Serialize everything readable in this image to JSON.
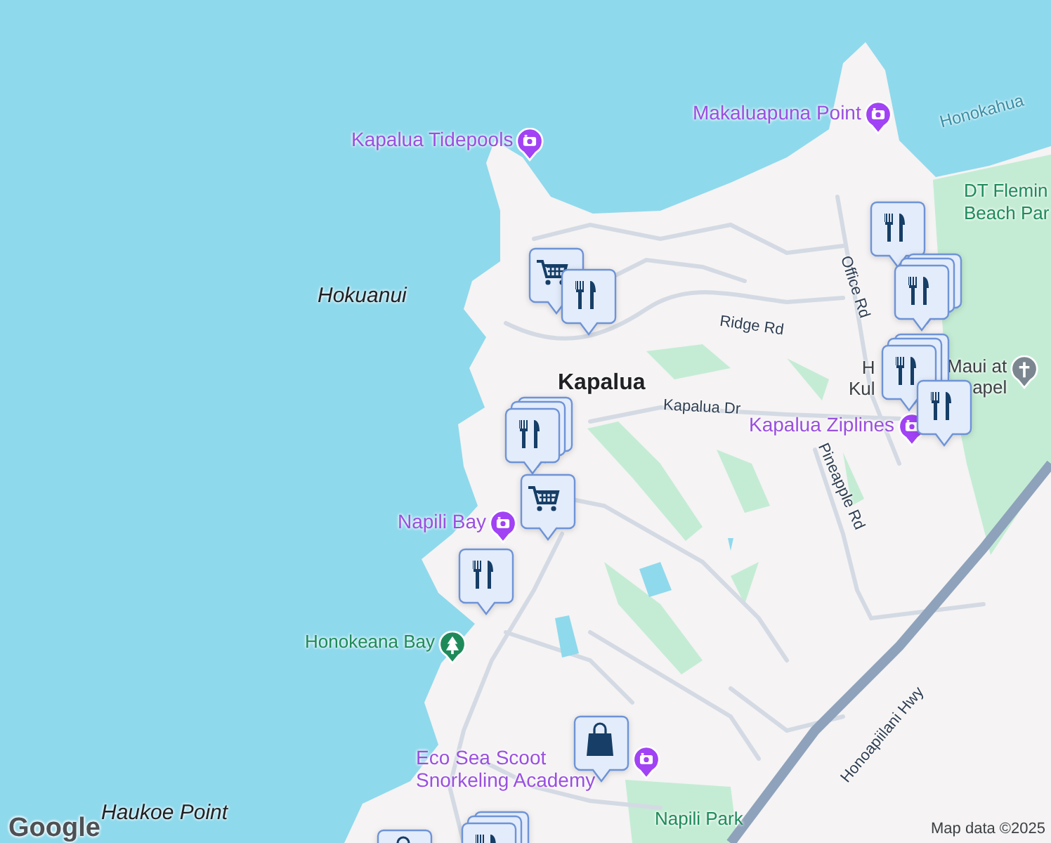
{
  "map": {
    "labels": [
      {
        "kind": "poi",
        "lines": [
          "Makaluapuna Point"
        ],
        "pinned": true
      },
      {
        "kind": "water",
        "lines": [
          "Honokahua"
        ]
      },
      {
        "kind": "poi",
        "lines": [
          "Kapalua Tidepools"
        ],
        "pinned": true
      },
      {
        "kind": "park",
        "lines": [
          "DT Flemin",
          "Beach Par"
        ]
      },
      {
        "kind": "area",
        "lines": [
          "Hokuanui"
        ]
      },
      {
        "kind": "road",
        "lines": [
          "Office Rd"
        ]
      },
      {
        "kind": "road",
        "lines": [
          "Ridge Rd"
        ]
      },
      {
        "kind": "town",
        "lines": [
          "Kapalua"
        ]
      },
      {
        "kind": "road",
        "lines": [
          "Kapalua Dr"
        ]
      },
      {
        "kind": "church",
        "lines": [
          "H",
          "Kul"
        ]
      },
      {
        "kind": "church",
        "lines": [
          "Maui at",
          "apel"
        ],
        "pinned": true
      },
      {
        "kind": "poi",
        "lines": [
          "Kapalua Ziplines"
        ],
        "pinned": true
      },
      {
        "kind": "road",
        "lines": [
          "Pineapple Rd"
        ]
      },
      {
        "kind": "poi",
        "lines": [
          "Napili Bay"
        ],
        "pinned": true
      },
      {
        "kind": "park",
        "lines": [
          "Honokeana Bay"
        ],
        "pinned": true
      },
      {
        "kind": "road",
        "lines": [
          "Honoapiilani Hwy"
        ]
      },
      {
        "kind": "poi",
        "lines": [
          "Eco Sea Scoot",
          "Snorkeling Academy"
        ],
        "pinned": true
      },
      {
        "kind": "park",
        "lines": [
          "Napili Park"
        ]
      },
      {
        "kind": "area",
        "lines": [
          "Haukoe Point"
        ]
      }
    ],
    "markers": [
      {
        "kind": "restaurant",
        "stacked": false
      },
      {
        "kind": "restaurant",
        "stacked": true
      },
      {
        "kind": "restaurant",
        "stacked": true
      },
      {
        "kind": "restaurant",
        "stacked": false
      },
      {
        "kind": "grocery",
        "stacked": false
      },
      {
        "kind": "restaurant",
        "stacked": false
      },
      {
        "kind": "restaurant",
        "stacked": true
      },
      {
        "kind": "grocery",
        "stacked": false
      },
      {
        "kind": "restaurant",
        "stacked": false
      },
      {
        "kind": "shopping",
        "stacked": false
      },
      {
        "kind": "shopping",
        "stacked": false
      },
      {
        "kind": "restaurant",
        "stacked": true
      }
    ],
    "logo": "Google",
    "attribution": "Map data ©2025"
  }
}
